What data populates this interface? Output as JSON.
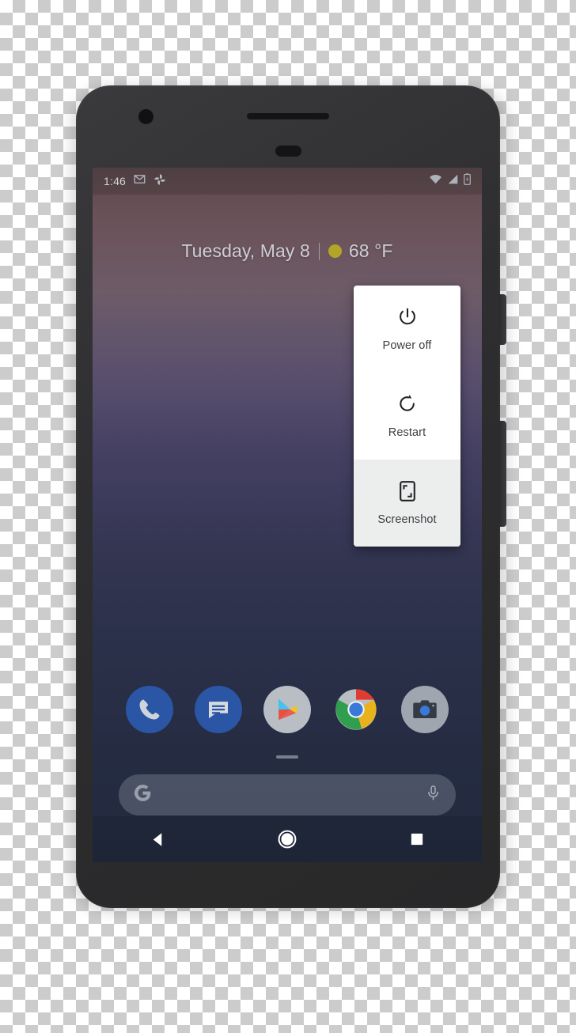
{
  "device": {
    "frame_color": "#2e2e30",
    "parts": {
      "camera": "front-camera-dot",
      "earpiece": "speaker-grille",
      "sensor": "proximity-sensor",
      "power_button": "power-side-button",
      "volume_button": "volume-rocker-button"
    }
  },
  "status_bar": {
    "time": "1:46",
    "left_icons": [
      {
        "name": "gmail-icon",
        "label": "Gmail"
      },
      {
        "name": "google-photos-icon",
        "label": "Google Photos"
      }
    ],
    "right_icons": [
      {
        "name": "wifi-icon",
        "label": "Wi-Fi"
      },
      {
        "name": "cell-signal-icon",
        "label": "Mobile signal"
      },
      {
        "name": "battery-charging-icon",
        "label": "Battery charging"
      }
    ]
  },
  "home_screen": {
    "date_widget": {
      "date": "Tuesday, May 8",
      "separator": "|",
      "weather_icon": "sunny-icon",
      "weather_color": "#b3a528",
      "temperature": "68 °F"
    },
    "search": {
      "logo": "google-g-icon",
      "placeholder": "",
      "value": "",
      "mic_icon": "microphone-icon"
    },
    "page_indicator": "home-page-dash",
    "dock": [
      {
        "name": "phone-app",
        "label": "Phone",
        "color": "#2a56a5"
      },
      {
        "name": "messages-app",
        "label": "Messages",
        "color": "#2a56a5"
      },
      {
        "name": "play-store-app",
        "label": "Play Store",
        "color": "#b9bdc4"
      },
      {
        "name": "chrome-app",
        "label": "Chrome",
        "color": "#d93025"
      },
      {
        "name": "camera-app",
        "label": "Camera",
        "color": "#9fa6af"
      }
    ]
  },
  "power_menu": {
    "background": "#ffffff",
    "pressed_background": "#eceded",
    "items": [
      {
        "label": "Power off",
        "icon": "power-icon",
        "pressed": false
      },
      {
        "label": "Restart",
        "icon": "restart-icon",
        "pressed": false
      },
      {
        "label": "Screenshot",
        "icon": "screenshot-icon",
        "pressed": true
      }
    ]
  },
  "nav_bar": {
    "buttons": [
      {
        "name": "back-button",
        "icon": "back-triangle-icon",
        "label": "Back"
      },
      {
        "name": "home-button",
        "icon": "home-circle-icon",
        "label": "Home"
      },
      {
        "name": "recents-button",
        "icon": "recents-square-icon",
        "label": "Recents"
      }
    ]
  }
}
